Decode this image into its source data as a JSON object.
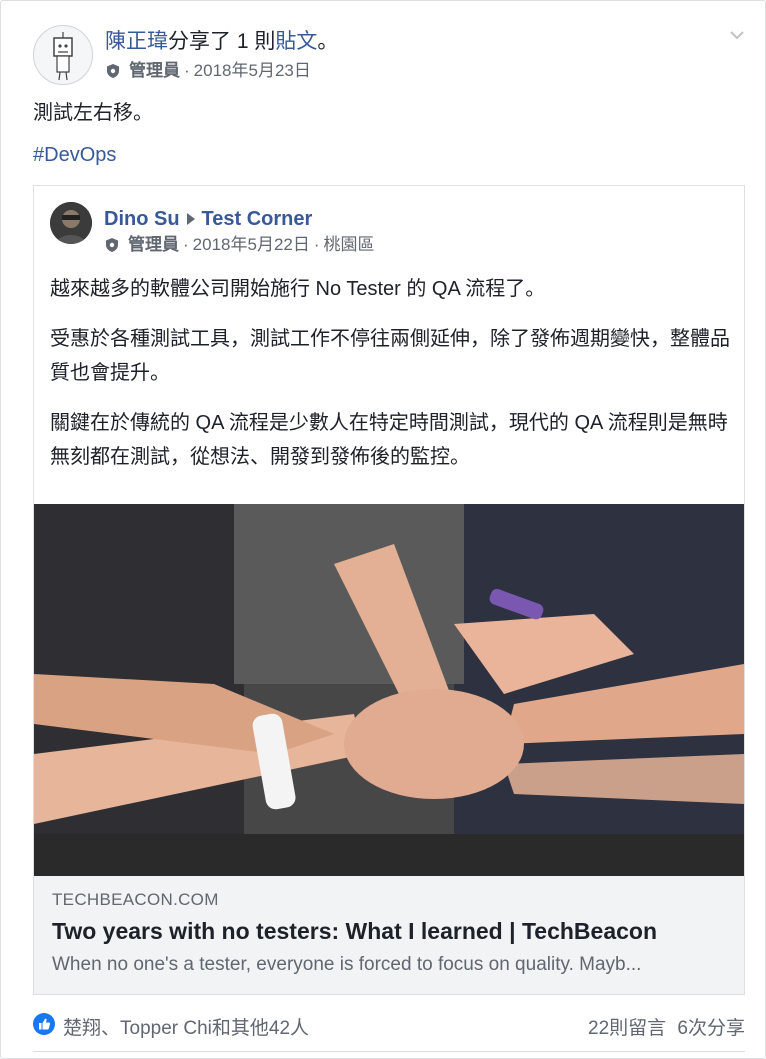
{
  "post": {
    "author": "陳正瑋",
    "action_pre": "分享了 1 則",
    "action_link": "貼文",
    "action_post": "。",
    "role": "管理員",
    "date": "2018年5月23日",
    "text": "測試左右移。",
    "hashtag": "#DevOps"
  },
  "shared": {
    "author": "Dino Su",
    "group": "Test Corner",
    "role": "管理員",
    "date": "2018年5月22日",
    "location": "桃園區",
    "paragraphs": [
      "越來越多的軟體公司開始施行 No Tester 的 QA 流程了。",
      "受惠於各種測試工具，測試工作不停往兩側延伸，除了發佈週期變快，整體品質也會提升。",
      "關鍵在於傳統的 QA 流程是少數人在特定時間測試，現代的 QA 流程則是無時無刻都在測試，從想法、開發到發佈後的監控。"
    ],
    "link": {
      "domain": "TECHBEACON.COM",
      "title": "Two years with no testers: What I learned | TechBeacon",
      "description": "When no one's a tester, everyone is forced to focus on quality. Mayb..."
    }
  },
  "footer": {
    "reactors": "楚翔、Topper Chi和其他42人",
    "comments": "22則留言",
    "shares": "6次分享"
  },
  "sep": " · "
}
